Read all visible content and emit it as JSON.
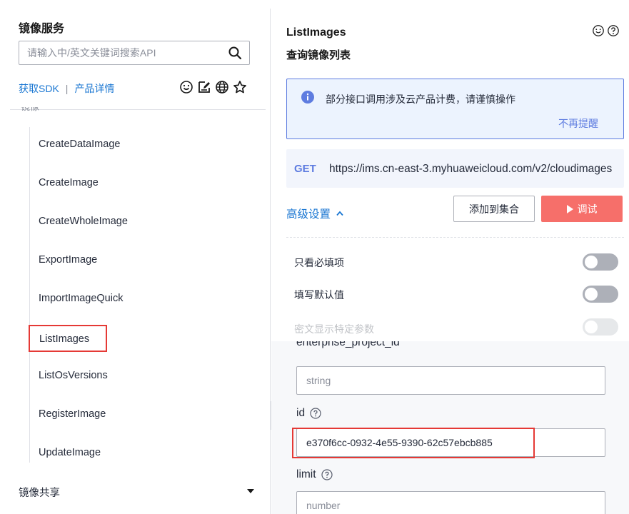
{
  "sidebar": {
    "title": "镜像服务",
    "search_placeholder": "请输入中/英文关键词搜索API",
    "links": {
      "sdk": "获取SDK",
      "separator": "|",
      "details": "产品详情"
    },
    "clipped_group_label": "镜像",
    "api_items": [
      {
        "label": "CreateDataImage"
      },
      {
        "label": "CreateImage"
      },
      {
        "label": "CreateWholeImage"
      },
      {
        "label": "ExportImage"
      },
      {
        "label": "ImportImageQuick"
      },
      {
        "label": "ListImages",
        "selected": true
      },
      {
        "label": "ListOsVersions"
      },
      {
        "label": "RegisterImage"
      },
      {
        "label": "UpdateImage"
      }
    ],
    "bottom_group": "镜像共享",
    "icons": [
      "search-icon",
      "smile-icon",
      "edit-icon",
      "globe-icon",
      "star-icon",
      "caret-down-icon",
      "collapse-left-icon"
    ]
  },
  "detail": {
    "api_name": "ListImages",
    "api_desc": "查询镜像列表",
    "notice": {
      "message": "部分接口调用涉及云产品计费，请谨慎操作",
      "dismiss": "不再提醒"
    },
    "request": {
      "method": "GET",
      "url": "https://ims.cn-east-3.myhuaweicloud.com/v2/cloudimages"
    },
    "advanced_label": "高级设置",
    "buttons": {
      "add_collection": "添加到集合",
      "debug": "调试"
    },
    "options": [
      {
        "label": "只看必填项",
        "on": false
      },
      {
        "label": "填写默认值",
        "on": false
      },
      {
        "label": "密文显示特定参数",
        "on": false,
        "disabled": true
      }
    ],
    "params": {
      "clipped_label": "enterprise_project_id",
      "enterprise_project_id_placeholder": "string",
      "id_label": "id",
      "id_value": "e370f6cc-0932-4e55-9390-62c57ebcb885",
      "limit_label": "limit",
      "limit_placeholder": "number"
    }
  },
  "colors": {
    "link": "#1976d2",
    "accent": "#5e7ce0",
    "danger_button": "#f66f6a",
    "highlight_box": "#e53935",
    "notice_bg": "#ecf3fe"
  }
}
